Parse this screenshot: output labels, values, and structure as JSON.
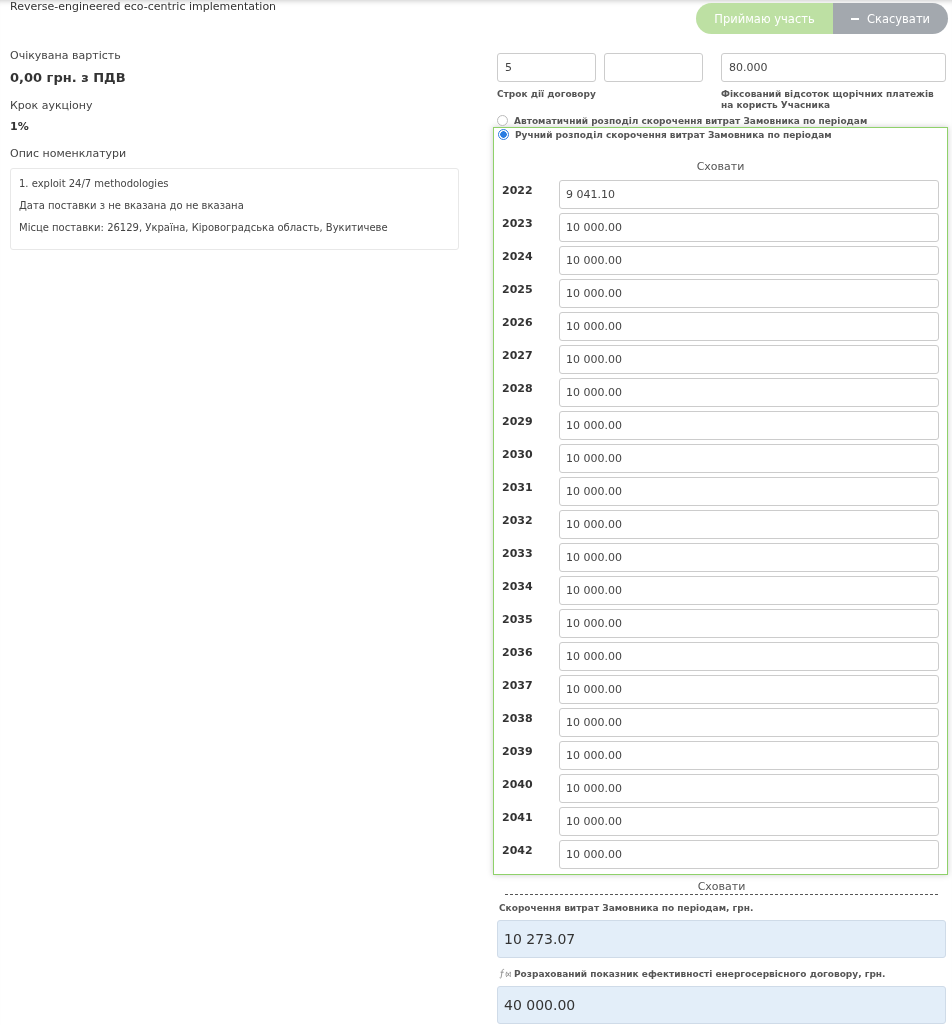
{
  "title": "Reverse-engineered eco-centric implementation",
  "actions": [
    {
      "kind": "primary",
      "label": "Приймаю участь",
      "disabled": true
    },
    {
      "kind": "cancel",
      "label": "Скасувати",
      "disabled": true
    }
  ],
  "summary": [
    {
      "label": "Очікувана вартість",
      "value": "0,00 грн. з ПДВ",
      "kind": "large"
    },
    {
      "label": "Крок аукціону",
      "value": "1%",
      "kind": "small"
    }
  ],
  "nomenclature": {
    "label": "Опис номенклатури",
    "lines": [
      "1. exploit 24/7 methodologies",
      "Дата поставки з не вказана до не вказана",
      "Місце поставки: 26129, Україна, Кіровоградська область, Вукитичеве"
    ]
  },
  "contract": {
    "term_value": "5",
    "percent_value": "80.000",
    "term_label": "Строк дії договору",
    "percent_label": "Фіксований відсоток щорічних платежів на користь Учасника"
  },
  "distribution_options": [
    {
      "label": "Автоматичний розподіл скорочення витрат Замовника по періодам",
      "selected": false
    },
    {
      "label": "Ручний розподіл скорочення витрат Замовника по періодам",
      "selected": true
    }
  ],
  "periods": {
    "hide_top": "Сховати",
    "hide_bottom": "Сховати",
    "rows": [
      {
        "year": "2022",
        "value": "9 041.10"
      },
      {
        "year": "2023",
        "value": "10 000.00"
      },
      {
        "year": "2024",
        "value": "10 000.00"
      },
      {
        "year": "2025",
        "value": "10 000.00"
      },
      {
        "year": "2026",
        "value": "10 000.00"
      },
      {
        "year": "2027",
        "value": "10 000.00"
      },
      {
        "year": "2028",
        "value": "10 000.00"
      },
      {
        "year": "2029",
        "value": "10 000.00"
      },
      {
        "year": "2030",
        "value": "10 000.00"
      },
      {
        "year": "2031",
        "value": "10 000.00"
      },
      {
        "year": "2032",
        "value": "10 000.00"
      },
      {
        "year": "2033",
        "value": "10 000.00"
      },
      {
        "year": "2034",
        "value": "10 000.00"
      },
      {
        "year": "2035",
        "value": "10 000.00"
      },
      {
        "year": "2036",
        "value": "10 000.00"
      },
      {
        "year": "2037",
        "value": "10 000.00"
      },
      {
        "year": "2038",
        "value": "10 000.00"
      },
      {
        "year": "2039",
        "value": "10 000.00"
      },
      {
        "year": "2040",
        "value": "10 000.00"
      },
      {
        "year": "2041",
        "value": "10 000.00"
      },
      {
        "year": "2042",
        "value": "10 000.00"
      }
    ]
  },
  "results": [
    {
      "label": "Скорочення витрат Замовника по періодам, грн.",
      "value": "10 273.07",
      "formula": false
    },
    {
      "label": "Розрахований показник ефективності енергосервісного договору, грн.",
      "value": "40 000.00",
      "formula": true
    }
  ]
}
